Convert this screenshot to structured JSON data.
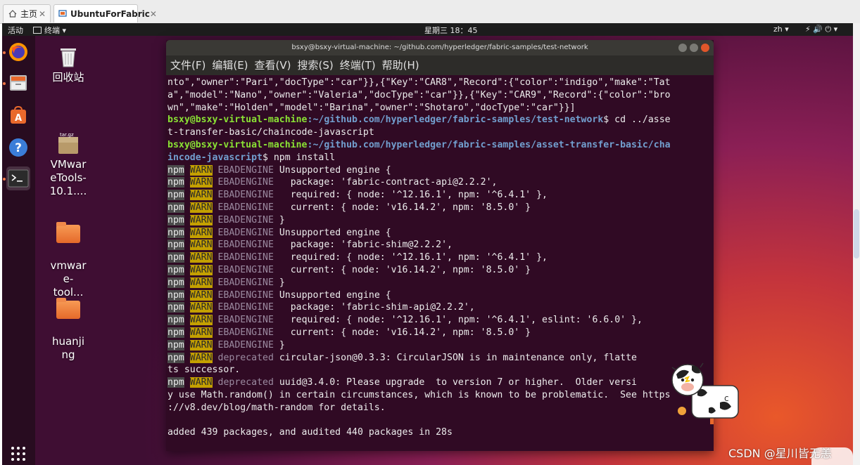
{
  "vmware": {
    "tabs": [
      {
        "label": "主页",
        "icon": "home-icon",
        "active": false
      },
      {
        "label": "UbuntuForFabric",
        "icon": "vm-icon",
        "active": true
      }
    ],
    "close_glyph": "✕"
  },
  "topbar": {
    "activities": "活动",
    "app_menu": "终端 ▾",
    "clock": "星期三 18：45",
    "lang": "zh ▾",
    "tray": "⚡ 🔊 ⏻ ▾"
  },
  "desktop_icons": [
    {
      "label": "回收站",
      "icon": "trash-icon"
    },
    {
      "label": "VMwar\neTools-\n10.1....",
      "icon": "archive-icon",
      "badge": "tar.gz"
    },
    {
      "label": "vmwar\ne-\ntool...",
      "icon": "folder-icon"
    },
    {
      "label": "huanji\nng",
      "icon": "folder-icon"
    }
  ],
  "terminal": {
    "title": "bsxy@bsxy-virtual-machine: ~/github.com/hyperledger/fabric-samples/test-network",
    "menu": [
      "文件(F)",
      "编辑(E)",
      "查看(V)",
      "搜索(S)",
      "终端(T)",
      "帮助(H)"
    ],
    "user_host": "bsxy@bsxy-virtual-machine",
    "lines": [
      {
        "type": "plain",
        "text": "nto\",\"owner\":\"Pari\",\"docType\":\"car\"}},{\"Key\":\"CAR8\",\"Record\":{\"color\":\"indigo\",\"make\":\"Tat"
      },
      {
        "type": "plain",
        "text": "a\",\"model\":\"Nano\",\"owner\":\"Valeria\",\"docType\":\"car\"}},{\"Key\":\"CAR9\",\"Record\":{\"color\":\"bro"
      },
      {
        "type": "plain",
        "text": "wn\",\"make\":\"Holden\",\"model\":\"Barina\",\"owner\":\"Shotaro\",\"docType\":\"car\"}}]"
      },
      {
        "type": "prompt",
        "path": ":~/github.com/hyperledger/fabric-samples/test-network",
        "cmd": "$ cd ../asse"
      },
      {
        "type": "plain",
        "text": "t-transfer-basic/chaincode-javascript"
      },
      {
        "type": "prompt",
        "path": ":~/github.com/hyperledger/fabric-samples/asset-transfer-basic/cha",
        "cmd": ""
      },
      {
        "type": "prompt2",
        "path": "incode-javascript",
        "cmd": "$ npm install"
      },
      {
        "type": "warn",
        "code": "EBADENGINE",
        "text": " Unsupported engine {"
      },
      {
        "type": "warn",
        "code": "EBADENGINE",
        "text": "   package: 'fabric-contract-api@2.2.2',"
      },
      {
        "type": "warn",
        "code": "EBADENGINE",
        "text": "   required: { node: '^12.16.1', npm: '^6.4.1' },"
      },
      {
        "type": "warn",
        "code": "EBADENGINE",
        "text": "   current: { node: 'v16.14.2', npm: '8.5.0' }"
      },
      {
        "type": "warn",
        "code": "EBADENGINE",
        "text": " }"
      },
      {
        "type": "warn",
        "code": "EBADENGINE",
        "text": " Unsupported engine {"
      },
      {
        "type": "warn",
        "code": "EBADENGINE",
        "text": "   package: 'fabric-shim@2.2.2',"
      },
      {
        "type": "warn",
        "code": "EBADENGINE",
        "text": "   required: { node: '^12.16.1', npm: '^6.4.1' },"
      },
      {
        "type": "warn",
        "code": "EBADENGINE",
        "text": "   current: { node: 'v16.14.2', npm: '8.5.0' }"
      },
      {
        "type": "warn",
        "code": "EBADENGINE",
        "text": " }"
      },
      {
        "type": "warn",
        "code": "EBADENGINE",
        "text": " Unsupported engine {"
      },
      {
        "type": "warn",
        "code": "EBADENGINE",
        "text": "   package: 'fabric-shim-api@2.2.2',"
      },
      {
        "type": "warn",
        "code": "EBADENGINE",
        "text": "   required: { node: '^12.16.1', npm: '^6.4.1', eslint: '6.6.0' },"
      },
      {
        "type": "warn",
        "code": "EBADENGINE",
        "text": "   current: { node: 'v16.14.2', npm: '8.5.0' }"
      },
      {
        "type": "warn",
        "code": "EBADENGINE",
        "text": " }"
      },
      {
        "type": "warn",
        "code": "deprecated",
        "text": " circular-json@0.3.3: CircularJSON is in maintenance only, flatte"
      },
      {
        "type": "plain",
        "text": "ts successor."
      },
      {
        "type": "warn",
        "code": "deprecated",
        "text": " uuid@3.4.0: Please upgrade  to version 7 or higher.  Older versi"
      },
      {
        "type": "plain",
        "text": "y use Math.random() in certain circumstances, which is known to be problematic.  See https"
      },
      {
        "type": "plain",
        "text": "://v8.dev/blog/math-random for details."
      },
      {
        "type": "plain",
        "text": ""
      },
      {
        "type": "plain",
        "text": "added 439 packages, and audited 440 packages in 28s"
      }
    ],
    "npm_label": "npm",
    "warn_label": "WARN"
  },
  "watermark": "CSDN @星川皆无恙",
  "colors": {
    "user": "#8ae234",
    "path": "#729fcf",
    "warn_bg": "#c4a000",
    "terminal_bg": "#300a24"
  }
}
